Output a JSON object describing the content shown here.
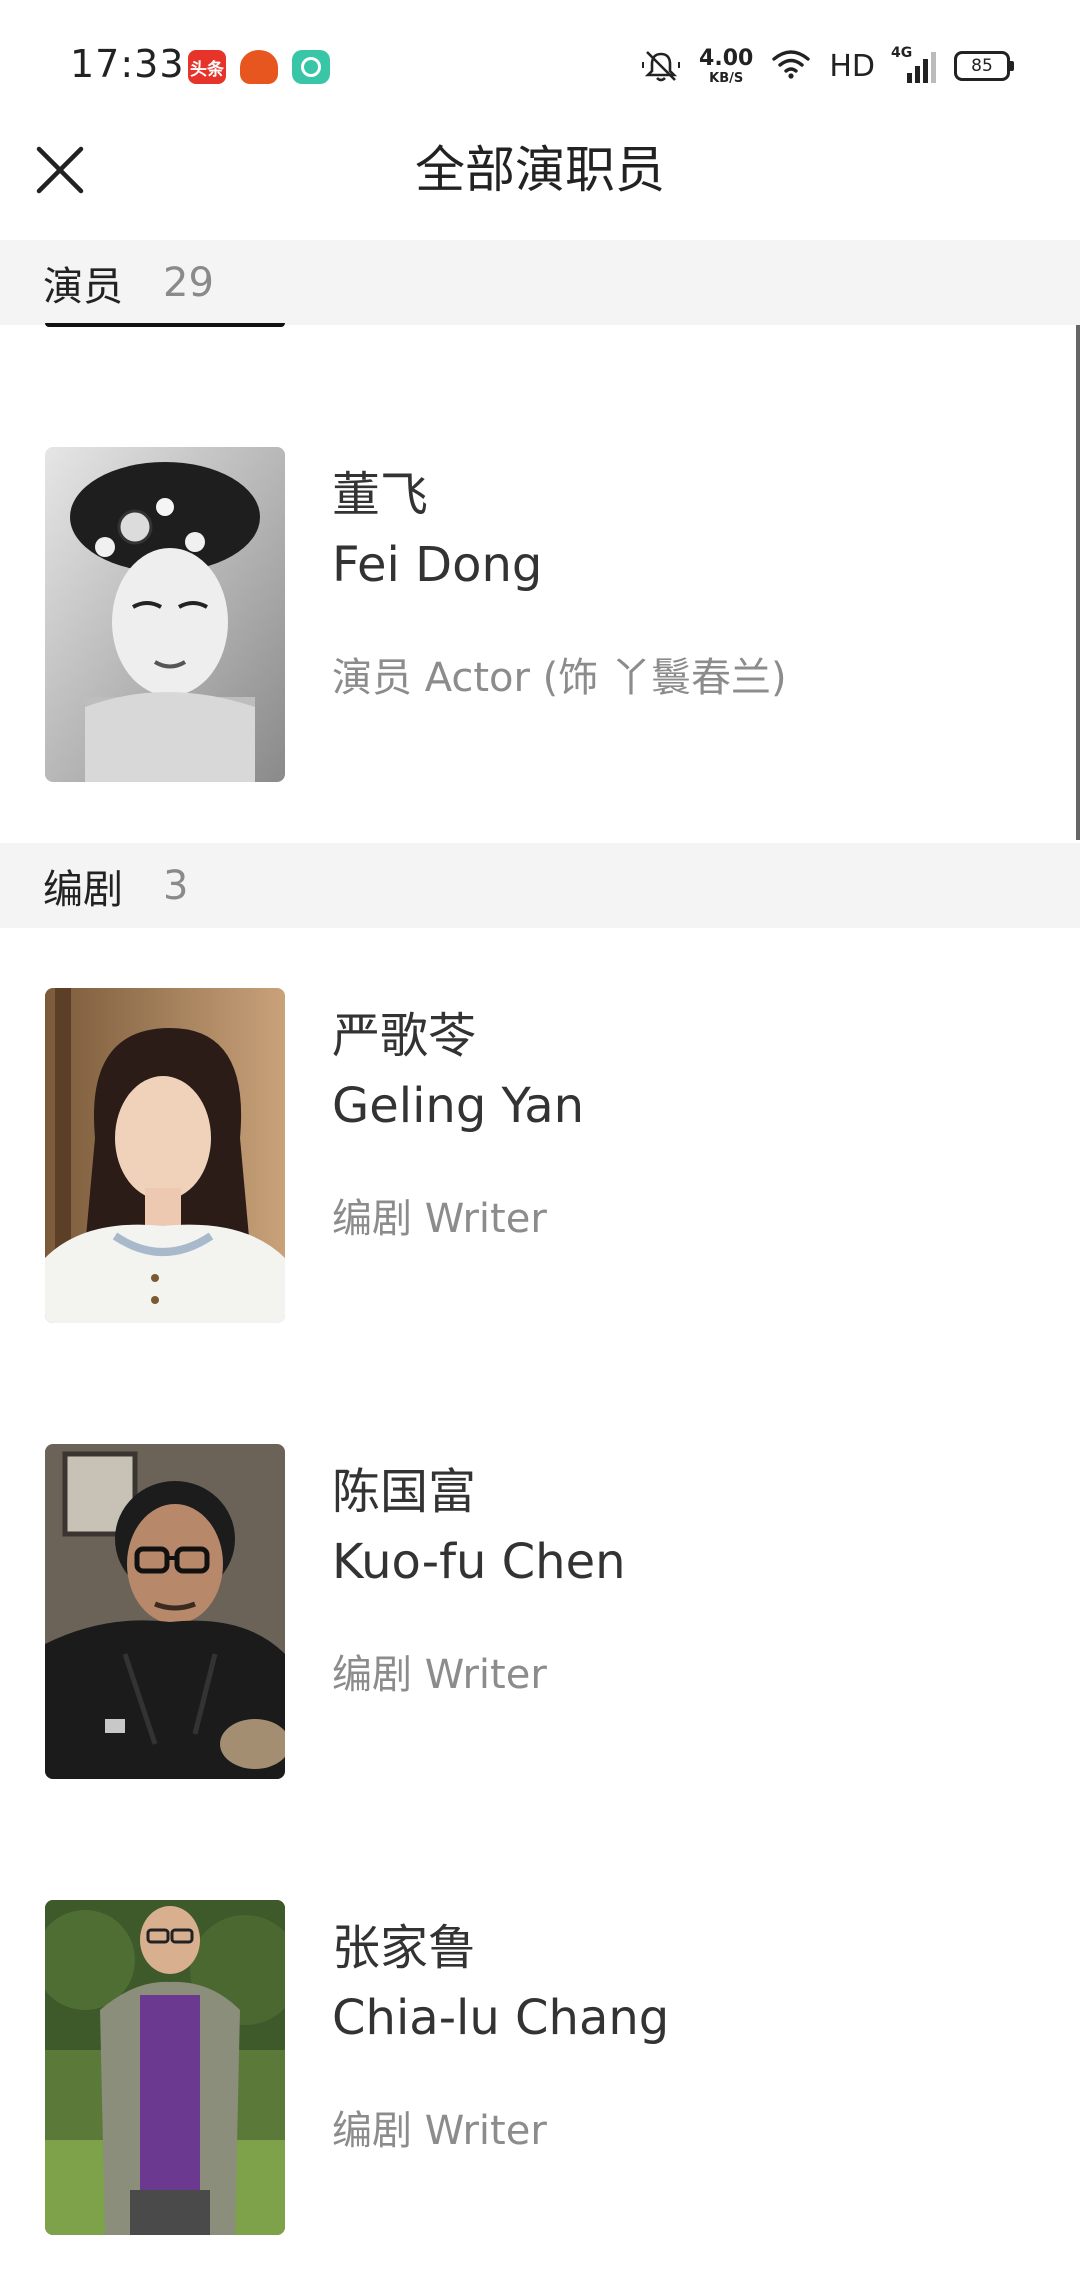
{
  "status_bar": {
    "time": "17:33",
    "apps": [
      "头条",
      "🔥",
      "○"
    ],
    "net_speed": "4.00",
    "net_unit": "KB/S",
    "hd": "HD",
    "network": "4G",
    "battery": "85"
  },
  "header": {
    "title": "全部演职员"
  },
  "sections": [
    {
      "title": "演员",
      "count": "29",
      "people": [
        {
          "name_zh": "董飞",
          "name_en": "Fei Dong",
          "role": "演员 Actor (饰 丫鬟春兰)"
        }
      ]
    },
    {
      "title": "编剧",
      "count": "3",
      "people": [
        {
          "name_zh": "严歌苓",
          "name_en": "Geling Yan",
          "role": "编剧 Writer"
        },
        {
          "name_zh": "陈国富",
          "name_en": "Kuo-fu Chen",
          "role": "编剧 Writer"
        },
        {
          "name_zh": "张家鲁",
          "name_en": "Chia-lu Chang",
          "role": "编剧 Writer"
        }
      ]
    }
  ]
}
